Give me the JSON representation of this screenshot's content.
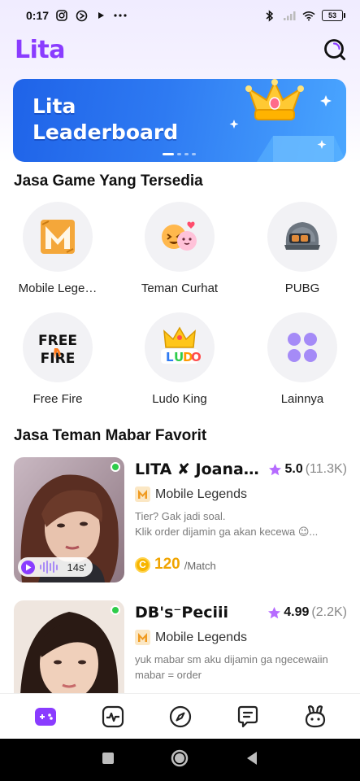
{
  "status_bar": {
    "time": "0:17",
    "battery": "53",
    "icons": [
      "instagram-icon",
      "sync-icon",
      "play-icon",
      "more-dots-icon",
      "bluetooth-icon",
      "signal-icon",
      "wifi-icon",
      "battery-icon"
    ]
  },
  "header": {
    "logo": "Lita",
    "search_icon": "search-icon"
  },
  "banner": {
    "title_line1": "Lita",
    "title_line2": "Leaderboard",
    "colors": {
      "start": "#1f63e8",
      "end": "#4aa6ff"
    }
  },
  "games_section": {
    "title": "Jasa Game Yang Tersedia",
    "items": [
      {
        "label": "Mobile Lege…",
        "icon": "mobile-legends-icon"
      },
      {
        "label": "Teman Curhat",
        "icon": "emoji-chat-icon"
      },
      {
        "label": "PUBG",
        "icon": "helmet-icon"
      },
      {
        "label": "Free Fire",
        "icon": "free-fire-icon"
      },
      {
        "label": "Ludo King",
        "icon": "ludo-crown-icon"
      },
      {
        "label": "Lainnya",
        "icon": "clover-grid-icon"
      }
    ]
  },
  "favorites_section": {
    "title": "Jasa Teman Mabar Favorit",
    "cards": [
      {
        "name": "LITA ✘ Joana…",
        "rating": "5.0",
        "rating_count": "(11.3K)",
        "game": "Mobile Legends",
        "desc_line1": "Tier? Gak jadi soal.",
        "desc_line2": "Klik order dijamin ga akan kecewa 😉...",
        "voice_duration": "14s'",
        "price": "120",
        "price_unit": "/Match",
        "coin_symbol": "C",
        "online": true
      },
      {
        "name": "DB's⁻Peciii",
        "rating": "4.99",
        "rating_count": "(2.2K)",
        "game": "Mobile Legends",
        "desc_line1": "yuk mabar sm aku dijamin ga ngecewaiin",
        "desc_line2": "mabar = order",
        "online": true
      }
    ]
  },
  "bottom_nav": {
    "items": [
      "games-icon",
      "activity-icon",
      "compass-icon",
      "chat-icon",
      "profile-bunny-icon"
    ],
    "active_color": "#8a3cff"
  },
  "android_nav": [
    "recents-icon",
    "home-icon",
    "back-icon"
  ],
  "colors": {
    "brand": "#8a3cff",
    "online": "#2ecc4a",
    "star": "#b66bff",
    "coin": "#f0a400"
  }
}
